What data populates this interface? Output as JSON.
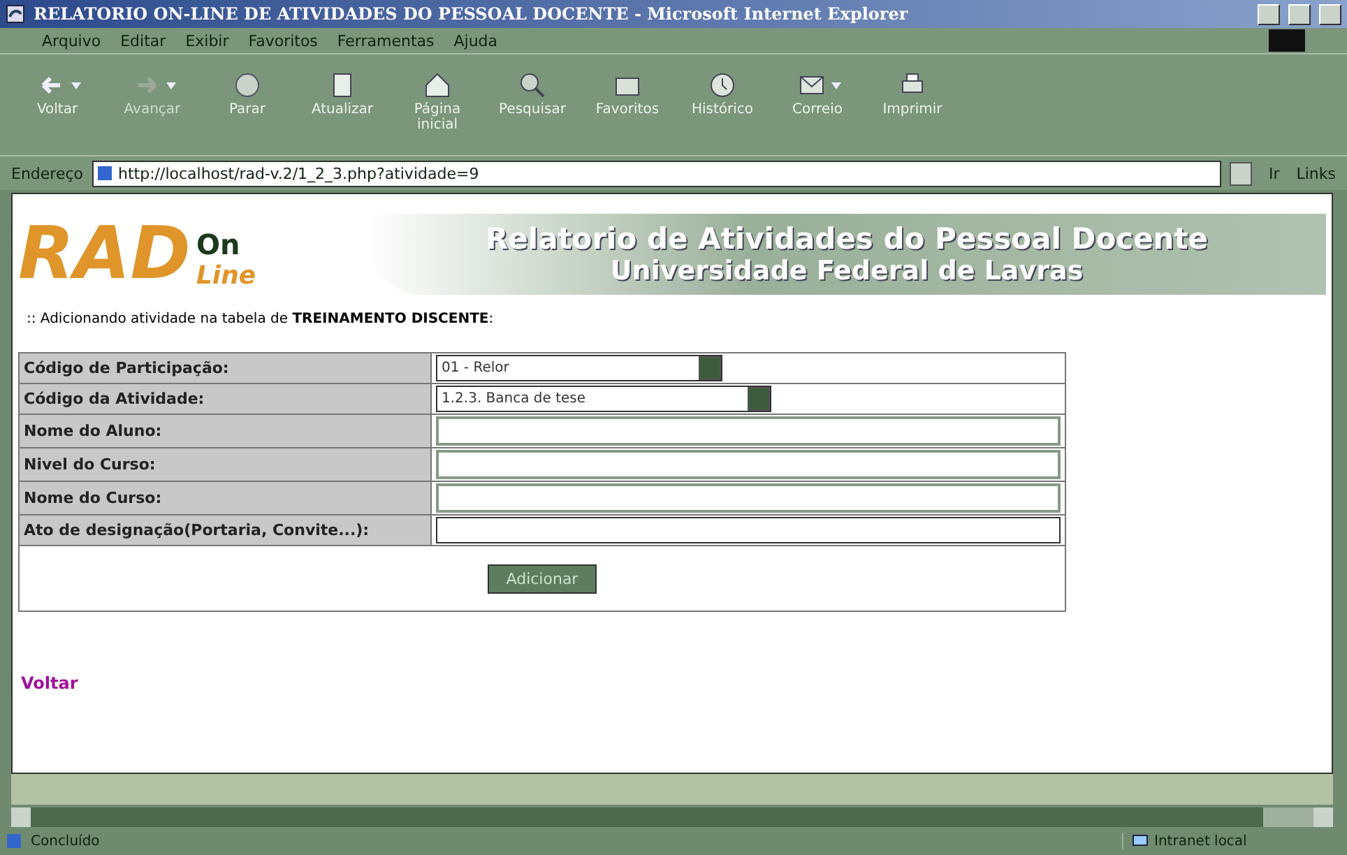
{
  "window": {
    "title": "RELATORIO ON-LINE DE ATIVIDADES DO PESSOAL DOCENTE - Microsoft Internet Explorer"
  },
  "menu": [
    "Arquivo",
    "Editar",
    "Exibir",
    "Favoritos",
    "Ferramentas",
    "Ajuda"
  ],
  "toolbar": [
    {
      "label": "Voltar",
      "kind": "back",
      "disabled": false,
      "dropdown": true
    },
    {
      "label": "Avançar",
      "kind": "forward",
      "disabled": true,
      "dropdown": true
    },
    {
      "label": "Parar",
      "kind": "stop",
      "disabled": false,
      "dropdown": false
    },
    {
      "label": "Atualizar",
      "kind": "refresh",
      "disabled": false,
      "dropdown": false
    },
    {
      "label": "Página inicial",
      "kind": "home",
      "disabled": false,
      "dropdown": false
    },
    {
      "label": "Pesquisar",
      "kind": "search",
      "disabled": false,
      "dropdown": false
    },
    {
      "label": "Favoritos",
      "kind": "favorites",
      "disabled": false,
      "dropdown": false
    },
    {
      "label": "Histórico",
      "kind": "history",
      "disabled": false,
      "dropdown": false
    },
    {
      "label": "Correio",
      "kind": "mail",
      "disabled": false,
      "dropdown": true
    },
    {
      "label": "Imprimir",
      "kind": "print",
      "disabled": false,
      "dropdown": false
    }
  ],
  "address": {
    "label": "Endereço",
    "url": "http://localhost/rad-v.2/1_2_3.php?atividade=9",
    "go": "Ir",
    "links": "Links"
  },
  "page": {
    "logo_main": "RAD",
    "logo_on": "On",
    "logo_line": "Line",
    "banner_title": "Relatorio de Atividades do Pessoal Docente",
    "banner_subtitle": "Universidade Federal de Lavras",
    "intro": ":: Adicionando atividade na tabela de **TREINAMENTO DISCENTE**:",
    "form": [
      {
        "label": "Código de Participação:",
        "kind": "select",
        "value": "01 - Relor"
      },
      {
        "label": "Código da Atividade:",
        "kind": "select",
        "value": "1.2.3. Banca de tese"
      },
      {
        "label": "Nome do Aluno:",
        "kind": "text"
      },
      {
        "label": "Nivel do Curso:",
        "kind": "text"
      },
      {
        "label": "Nome do Curso:",
        "kind": "text"
      },
      {
        "label": "Ato de designação(Portaria, Convite...):",
        "kind": "text"
      }
    ],
    "submit": "Adicionar",
    "back_link": "Voltar"
  },
  "status_bar": {
    "text": "Concluído",
    "zone": "Intranet local"
  }
}
